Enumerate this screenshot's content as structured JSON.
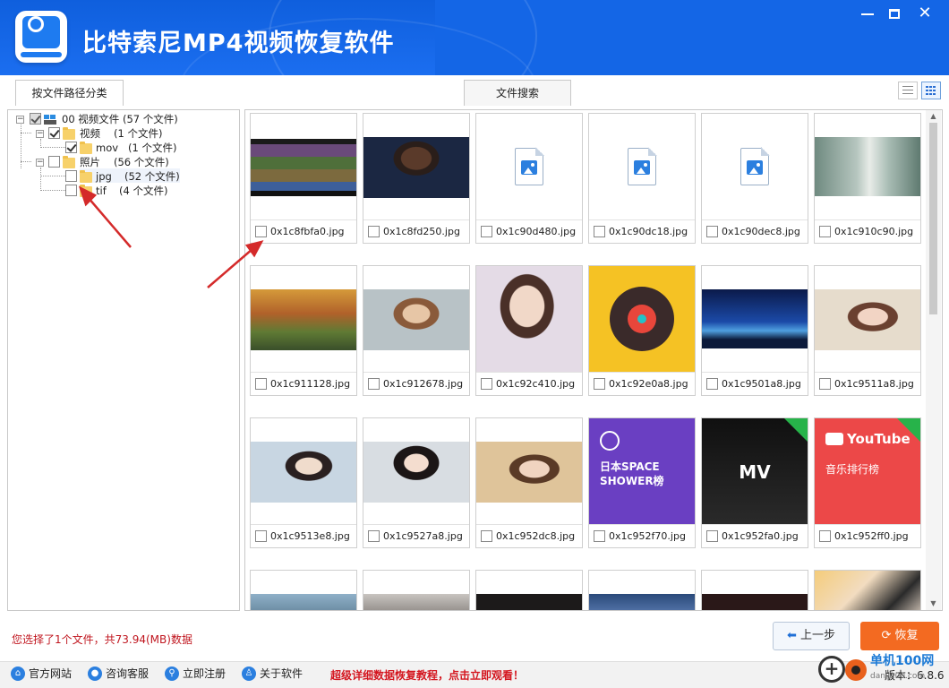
{
  "app": {
    "title": "比特索尼MP4视频恢复软件",
    "window_controls": [
      "minimize",
      "maximize",
      "close"
    ]
  },
  "tabs": {
    "path_label": "按文件路径分类",
    "search_label": "文件搜索"
  },
  "view": {
    "list_icon": "list-view-icon",
    "grid_icon": "grid-view-icon",
    "active": "grid"
  },
  "tree": [
    {
      "label": "00 视频文件",
      "count": "(57 个文件)",
      "state": "partial",
      "icon": "drive-icon"
    },
    {
      "label": "视频",
      "count": "(1 个文件)",
      "state": "checked",
      "icon": "folder-icon"
    },
    {
      "label": "mov",
      "count": "(1 个文件)",
      "state": "checked",
      "icon": "folder-icon"
    },
    {
      "label": "照片",
      "count": "(56 个文件)",
      "state": "unchecked",
      "icon": "folder-icon"
    },
    {
      "label": "jpg",
      "count": "(52 个文件)",
      "state": "unchecked",
      "icon": "folder-icon",
      "selected": true
    },
    {
      "label": "tif",
      "count": "(4 个文件)",
      "state": "unchecked",
      "icon": "folder-icon"
    }
  ],
  "files": [
    {
      "name": "0x1c8fbfa0.jpg",
      "thumb": "game"
    },
    {
      "name": "0x1c8fd250.jpg",
      "thumb": "portrait-dark"
    },
    {
      "name": "0x1c90d480.jpg",
      "thumb": "file-icon"
    },
    {
      "name": "0x1c90dc18.jpg",
      "thumb": "file-icon"
    },
    {
      "name": "0x1c90dec8.jpg",
      "thumb": "file-icon"
    },
    {
      "name": "0x1c910c90.jpg",
      "thumb": "photo-misty"
    },
    {
      "name": "0x1c911128.jpg",
      "thumb": "autumn-forest"
    },
    {
      "name": "0x1c912678.jpg",
      "thumb": "winter-girl"
    },
    {
      "name": "0x1c92c410.jpg",
      "thumb": "portrait-man"
    },
    {
      "name": "0x1c92e0a8.jpg",
      "thumb": "music-icon"
    },
    {
      "name": "0x1c9501a8.jpg",
      "thumb": "night-sky"
    },
    {
      "name": "0x1c9511a8.jpg",
      "thumb": "girl-cafe"
    },
    {
      "name": "0x1c9513e8.jpg",
      "thumb": "girl-hanfu"
    },
    {
      "name": "0x1c9527a8.jpg",
      "thumb": "girl-room"
    },
    {
      "name": "0x1c952dc8.jpg",
      "thumb": "girl-shop"
    },
    {
      "name": "0x1c952f70.jpg",
      "thumb": "space-shower",
      "text": "日本SPACE SHOWER榜"
    },
    {
      "name": "0x1c952fa0.jpg",
      "thumb": "mv",
      "text": "MV"
    },
    {
      "name": "0x1c952ff0.jpg",
      "thumb": "youtube",
      "text": "YouTube",
      "sub": "音乐排行榜"
    },
    {
      "name": "",
      "thumb": "landscape-1"
    },
    {
      "name": "",
      "thumb": "landscape-2"
    },
    {
      "name": "",
      "thumb": "dark-portrait"
    },
    {
      "name": "",
      "thumb": "mountains"
    },
    {
      "name": "",
      "thumb": "girl-dark"
    },
    {
      "name": "",
      "thumb": "anime-girl"
    }
  ],
  "status": {
    "selection_text": "您选择了1个文件，共73.94(MB)数据"
  },
  "buttons": {
    "prev_label": "上一步",
    "recover_label": "恢复"
  },
  "footer": {
    "items": [
      "官方网站",
      "咨询客服",
      "立即注册",
      "关于软件"
    ],
    "promo": "超级详细数据恢复教程，点击立即观看！",
    "version": "版本：6.8.6"
  },
  "watermark": {
    "title": "单机100网",
    "url": "danji100.com"
  }
}
